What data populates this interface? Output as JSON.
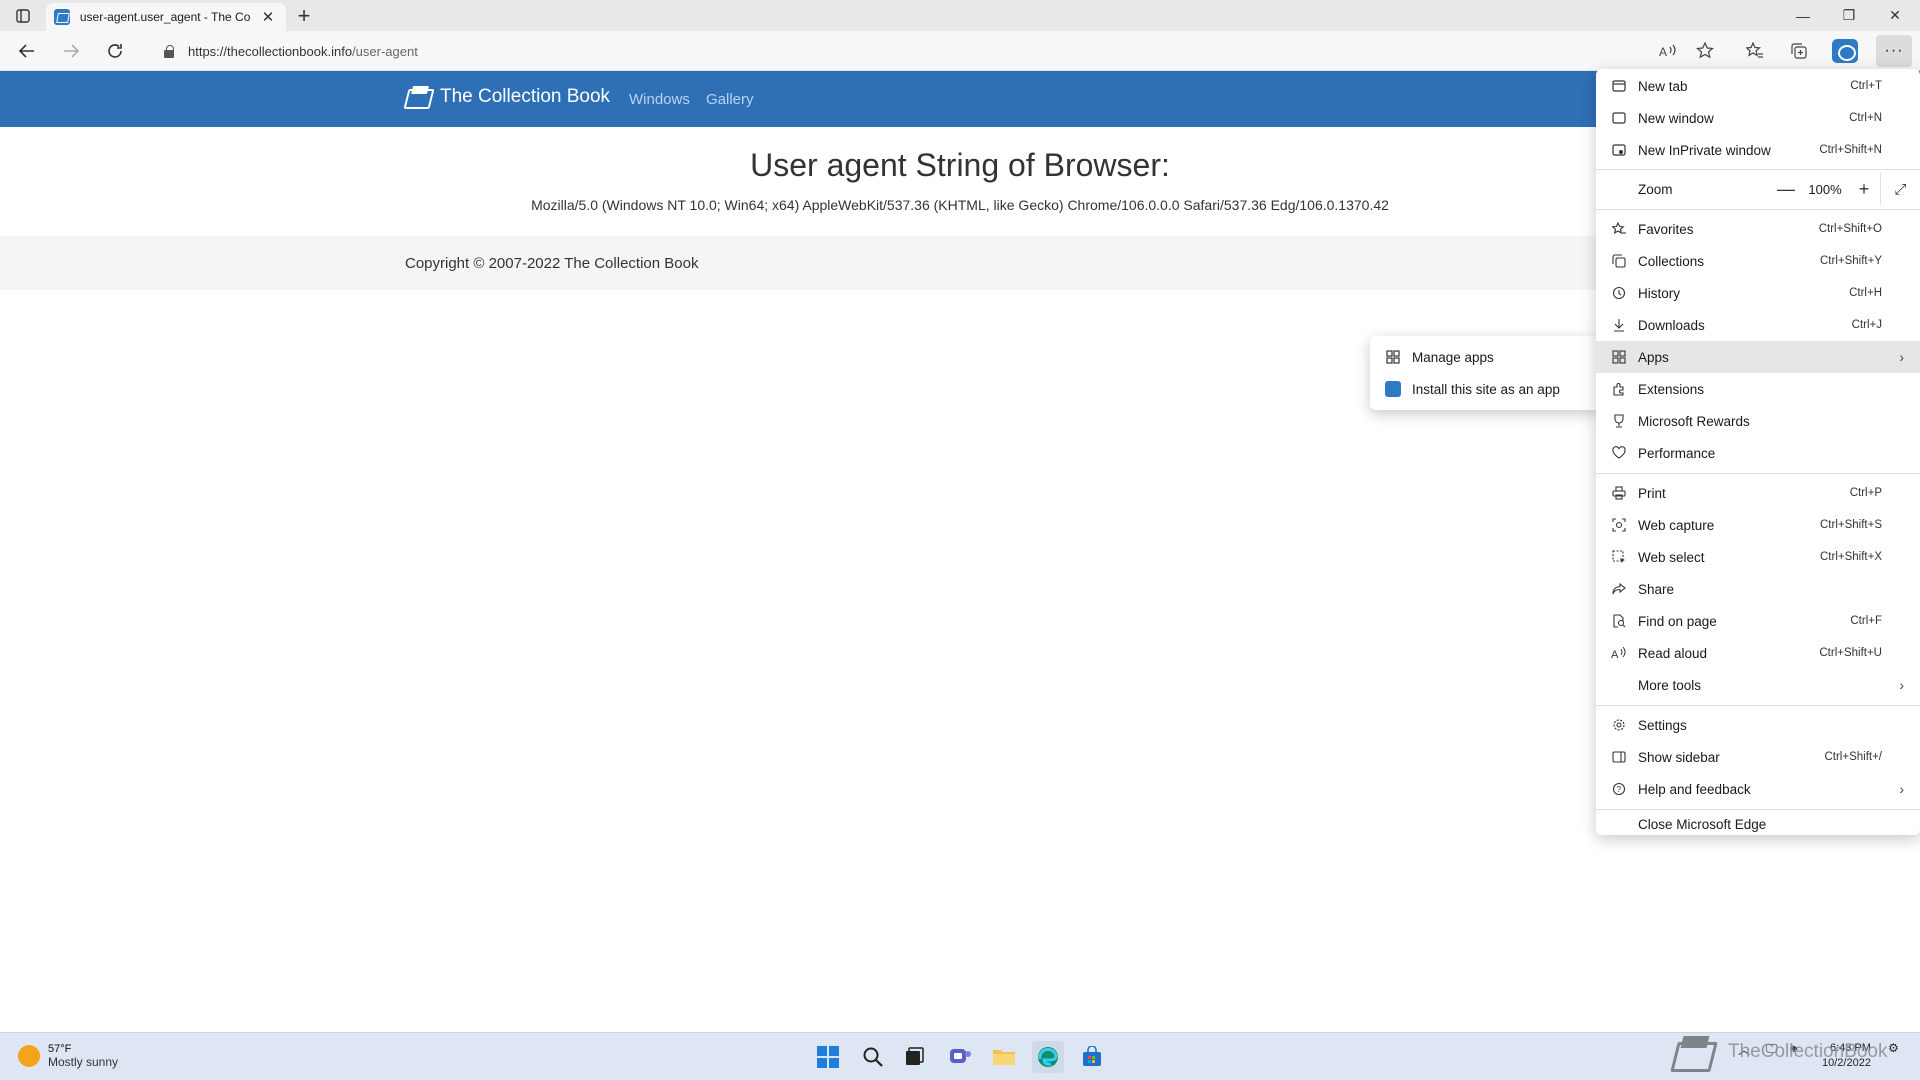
{
  "browser": {
    "tab_title": "user-agent.user_agent - The Coll",
    "tab_close": "✕",
    "new_tab": "+",
    "url_host": "https://thecollectionbook.info",
    "url_path": "/user-agent",
    "window_controls": {
      "minimize": "—",
      "maximize": "❐",
      "close": "✕"
    },
    "more_label": "···"
  },
  "site": {
    "brand": "The Collection Book",
    "nav": [
      "Windows",
      "Gallery"
    ],
    "heading": "User agent String of Browser:",
    "user_agent": "Mozilla/5.0 (Windows NT 10.0; Win64; x64) AppleWebKit/537.36 (KHTML, like Gecko) Chrome/106.0.0.0 Safari/537.36 Edg/106.0.1370.42",
    "copyright": "Copyright © 2007-2022 The Collection Book"
  },
  "menu": {
    "new_tab": {
      "label": "New tab",
      "shortcut": "Ctrl+T"
    },
    "new_window": {
      "label": "New window",
      "shortcut": "Ctrl+N"
    },
    "new_inprivate": {
      "label": "New InPrivate window",
      "shortcut": "Ctrl+Shift+N"
    },
    "zoom": {
      "label": "Zoom",
      "value": "100%",
      "minus": "—",
      "plus": "+"
    },
    "favorites": {
      "label": "Favorites",
      "shortcut": "Ctrl+Shift+O"
    },
    "collections": {
      "label": "Collections",
      "shortcut": "Ctrl+Shift+Y"
    },
    "history": {
      "label": "History",
      "shortcut": "Ctrl+H"
    },
    "downloads": {
      "label": "Downloads",
      "shortcut": "Ctrl+J"
    },
    "apps": {
      "label": "Apps"
    },
    "extensions": {
      "label": "Extensions"
    },
    "rewards": {
      "label": "Microsoft Rewards"
    },
    "performance": {
      "label": "Performance"
    },
    "print": {
      "label": "Print",
      "shortcut": "Ctrl+P"
    },
    "web_capture": {
      "label": "Web capture",
      "shortcut": "Ctrl+Shift+S"
    },
    "web_select": {
      "label": "Web select",
      "shortcut": "Ctrl+Shift+X"
    },
    "share": {
      "label": "Share"
    },
    "find": {
      "label": "Find on page",
      "shortcut": "Ctrl+F"
    },
    "read_aloud": {
      "label": "Read aloud",
      "shortcut": "Ctrl+Shift+U"
    },
    "more_tools": {
      "label": "More tools"
    },
    "settings": {
      "label": "Settings"
    },
    "sidebar": {
      "label": "Show sidebar",
      "shortcut": "Ctrl+Shift+/"
    },
    "help": {
      "label": "Help and feedback"
    },
    "close_edge": {
      "label": "Close Microsoft Edge"
    }
  },
  "apps_submenu": {
    "manage": "Manage apps",
    "install": "Install this site as an app"
  },
  "taskbar": {
    "temperature": "57°F",
    "condition": "Mostly sunny",
    "time": "6:43 PM",
    "date": "10/2/2022",
    "watermark": "TheCollectionBook"
  },
  "colors": {
    "site_header": "#2e6fb5",
    "accent": "#2e7bc4"
  }
}
